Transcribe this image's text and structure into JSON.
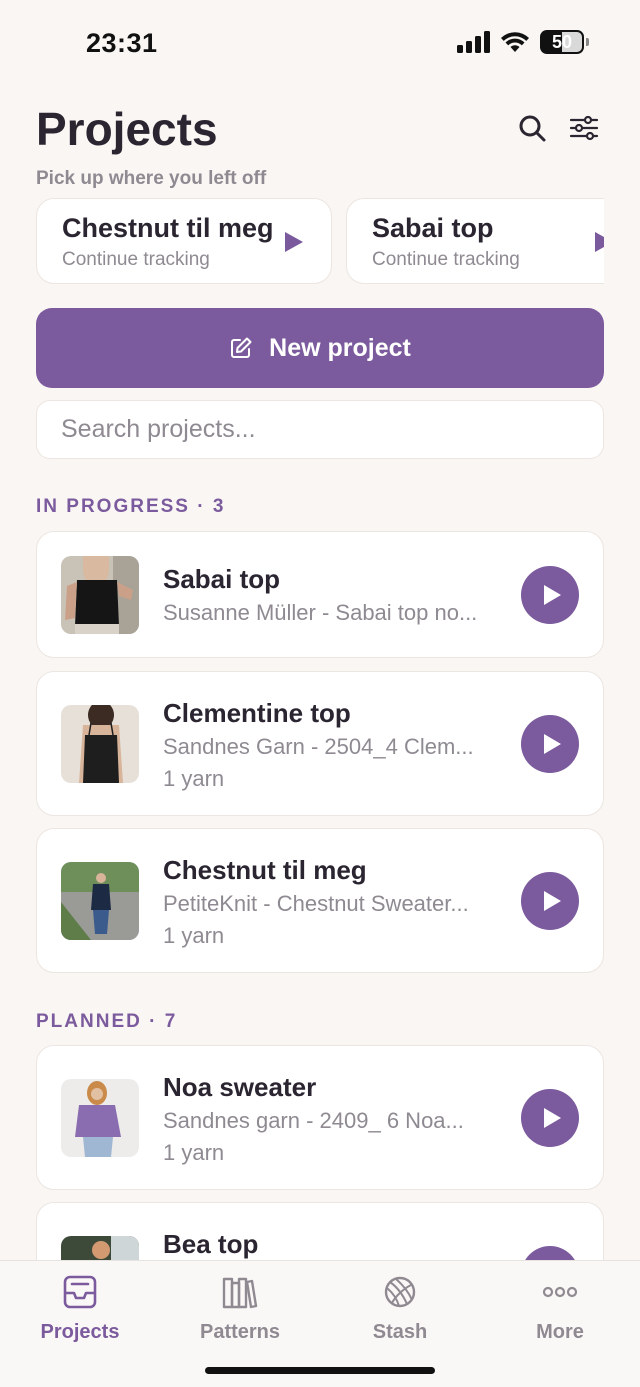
{
  "status_bar": {
    "time": "23:31",
    "battery": "50",
    "battery_level": 0.5
  },
  "header": {
    "title": "Projects"
  },
  "continue": {
    "label": "Pick up where you left off",
    "cards": [
      {
        "title": "Chestnut til meg",
        "subtitle": "Continue tracking"
      },
      {
        "title": "Sabai top",
        "subtitle": "Continue tracking"
      }
    ]
  },
  "new_project": {
    "label": "New project"
  },
  "search": {
    "placeholder": "Search projects..."
  },
  "sections": {
    "in_progress": {
      "label": "IN PROGRESS · 3",
      "items": [
        {
          "title": "Sabai top",
          "subtitle": "Susanne Müller - Sabai top no...",
          "yarn": ""
        },
        {
          "title": "Clementine top",
          "subtitle": "Sandnes Garn - 2504_4 Clem...",
          "yarn": "1 yarn"
        },
        {
          "title": "Chestnut til meg",
          "subtitle": "PetiteKnit - Chestnut Sweater...",
          "yarn": "1 yarn"
        }
      ]
    },
    "planned": {
      "label": "PLANNED · 7",
      "items": [
        {
          "title": "Noa sweater",
          "subtitle": "Sandnes garn - 2409_ 6 Noa...",
          "yarn": "1 yarn"
        },
        {
          "title": "Bea top",
          "subtitle": "",
          "yarn": ""
        }
      ]
    }
  },
  "tabs": [
    {
      "label": "Projects",
      "icon": "inbox-tray-icon",
      "active": true
    },
    {
      "label": "Patterns",
      "icon": "books-icon",
      "active": false
    },
    {
      "label": "Stash",
      "icon": "yarn-ball-icon",
      "active": false
    },
    {
      "label": "More",
      "icon": "more-dots-icon",
      "active": false
    }
  ],
  "colors": {
    "accent": "#7b5b9d",
    "background": "#f9f6f3",
    "text": "#2a2530",
    "muted": "#8f8a92"
  }
}
